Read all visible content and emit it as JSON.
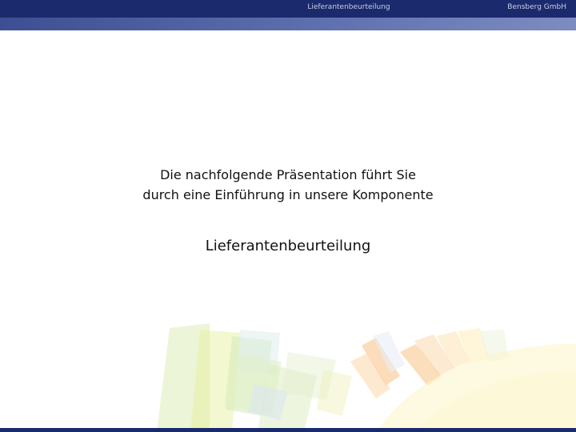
{
  "header": {
    "title": "Lieferantenbeurteilung",
    "company": "Bensberg GmbH"
  },
  "slide": {
    "intro_lines": [
      "Die nachfolgende Präsentation führt Sie",
      "durch eine Einführung in unsere Komponente"
    ],
    "subject": "Lieferantenbeurteilung"
  },
  "colors": {
    "header_bar": "#1a2a6c",
    "header_strip": "#5e6fae",
    "text": "#111111"
  }
}
